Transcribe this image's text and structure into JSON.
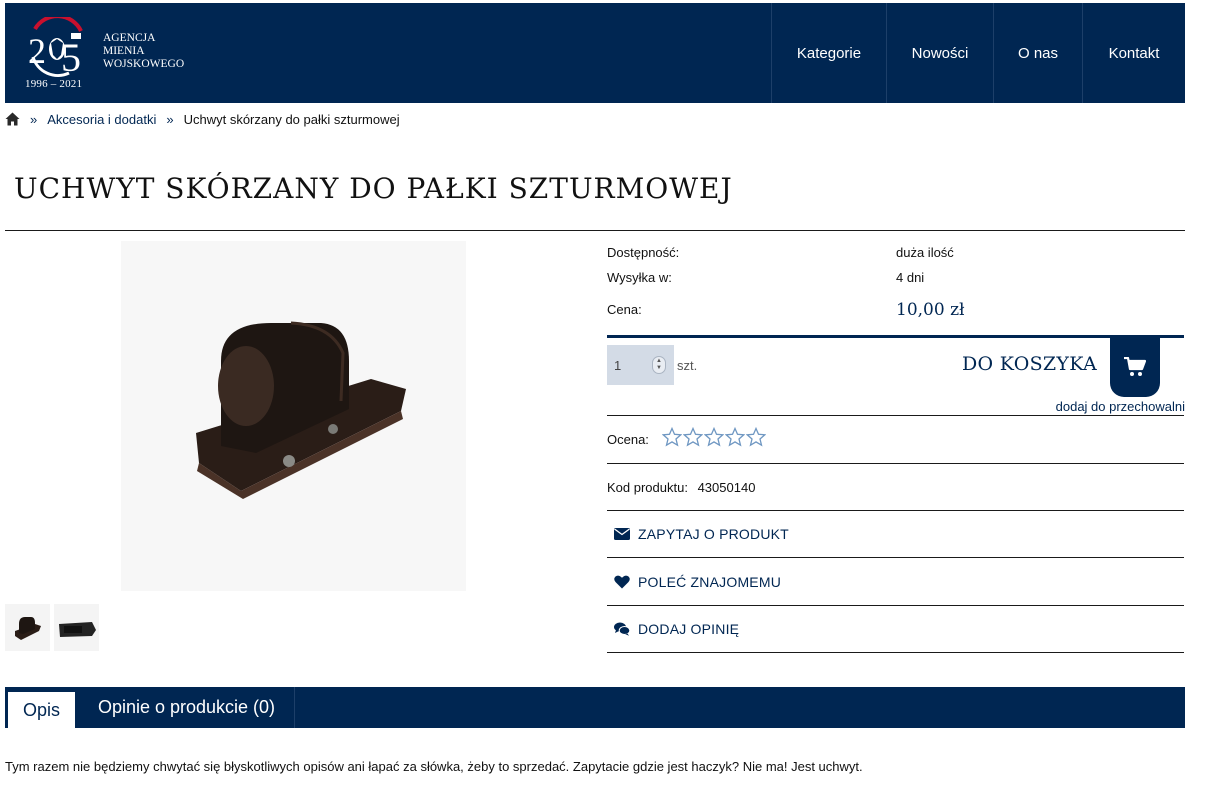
{
  "brand": {
    "years": "1996 – 2021",
    "org_line1": "AGENCJA",
    "org_line2": "MIENIA",
    "org_line3": "WOJSKOWEGO"
  },
  "nav": {
    "items": [
      "Kategorie",
      "Nowości",
      "O nas",
      "Kontakt"
    ]
  },
  "breadcrumb": {
    "sep": "»",
    "category": "Akcesoria i dodatki",
    "current": "Uchwyt skórzany do pałki szturmowej"
  },
  "product": {
    "title": "UCHWYT SKÓRZANY DO PAŁKI SZTURMOWEJ",
    "availability_label": "Dostępność:",
    "availability_value": "duża ilość",
    "shipping_label": "Wysyłka w:",
    "shipping_value": "4 dni",
    "price_label": "Cena:",
    "price_value": "10,00 zł",
    "quantity": "1",
    "unit": "szt.",
    "add_to_cart": "DO KOSZYKA",
    "wishlist": "dodaj do przechowalni",
    "rating_label": "Ocena:",
    "rating_stars_filled": 0,
    "rating_stars_total": 5,
    "code_label": "Kod produktu:",
    "code_value": "43050140"
  },
  "actions": {
    "ask": "ZAPYTAJ O PRODUKT",
    "recommend": "POLEĆ ZNAJOMEMU",
    "review": "DODAJ OPINIĘ"
  },
  "tabs": {
    "description": "Opis",
    "reviews": "Opinie o produkcie (0)"
  },
  "description": "Tym razem nie będziemy chwytać się błyskotliwych opisów ani łapać za słówka, żeby to sprzedać. Zapytacie gdzie jest haczyk? Nie ma! Jest uchwyt.",
  "colors": {
    "brand": "#002652",
    "qty_bg": "#d3dbe6",
    "star_outline": "#6f97c2",
    "accent_red": "#c8102e"
  }
}
